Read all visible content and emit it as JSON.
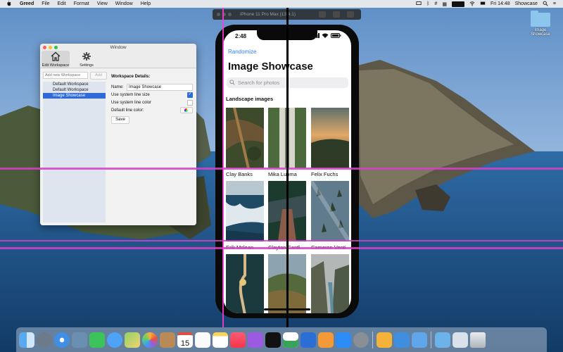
{
  "menubar": {
    "app_name": "Greed",
    "items": [
      "File",
      "Edit",
      "Format",
      "View",
      "Window",
      "Help"
    ],
    "clock": "Fri 14:48",
    "active_workspace": "Showcase"
  },
  "desktop": {
    "icon_label": "Image Showcase"
  },
  "window": {
    "title": "Window",
    "toolbar": [
      {
        "label": "Edit Workspace",
        "icon": "house-icon",
        "active": true
      },
      {
        "label": "Settings",
        "icon": "gear-icon",
        "active": false
      }
    ],
    "add_placeholder": "Add new Workspace",
    "add_button": "Add",
    "workspaces": [
      "Default Workspace",
      "Default Workspace",
      "Image Showcase"
    ],
    "selected_index": 2,
    "details": {
      "title": "Workspace Details:",
      "name_label": "Name:",
      "name_value": "Image Showcase",
      "system_line_size_label": "Use system line size",
      "system_line_size": true,
      "system_line_color_label": "Use system line color",
      "system_line_color": false,
      "default_line_color_label": "Default line color:",
      "save_label": "Save"
    }
  },
  "simulator": {
    "title": "iPhone 11 Pro Max (13.4.1)",
    "status_time": "2:48",
    "randomize_label": "Randomize",
    "page_title": "Image Showcase",
    "search_placeholder": "Search for photos",
    "section_title": "Landscape images",
    "photos": [
      {
        "caption": "Clay Banks"
      },
      {
        "caption": "Mika Luoma"
      },
      {
        "caption": "Felix Fuchs"
      },
      {
        "caption": "Erik Mclean"
      },
      {
        "caption": "Clayton Cardi..."
      },
      {
        "caption": "Cameron Venti"
      },
      {
        "caption": ""
      },
      {
        "caption": ""
      },
      {
        "caption": ""
      }
    ]
  },
  "colors": {
    "accent": "#2f6ad9",
    "link": "#2f7df6",
    "guide": "#ff3bd6"
  },
  "dock": {
    "icons": [
      "finder-icon",
      "launchpad-icon",
      "safari-icon",
      "mail-icon",
      "facetime-icon",
      "messages-icon",
      "maps-icon",
      "photos-icon",
      "contacts-icon",
      "calendar-icon",
      "reminders-icon",
      "notes-icon",
      "music-icon",
      "podcasts-icon",
      "tv-icon",
      "numbers-icon",
      "keynote-icon",
      "pages-icon",
      "app-store-icon",
      "system-preferences-icon",
      "greed-icon",
      "xcode-icon",
      "simulator-icon",
      "folder-icon",
      "downloads-icon",
      "trash-icon"
    ],
    "calendar_day": "15"
  }
}
